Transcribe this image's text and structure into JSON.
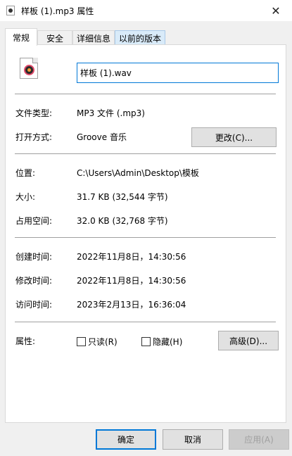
{
  "window": {
    "title": "样板 (1).mp3 属性"
  },
  "tabs": [
    {
      "label": "常规",
      "active": true
    },
    {
      "label": "安全",
      "active": false
    },
    {
      "label": "详细信息",
      "active": false
    },
    {
      "label": "以前的版本",
      "active": false
    }
  ],
  "file": {
    "name_value": "样板 (1).wav"
  },
  "general": {
    "type_label": "文件类型:",
    "type_value": "MP3 文件 (.mp3)",
    "opens_label": "打开方式:",
    "opens_value": "Groove 音乐",
    "change_button": "更改(C)...",
    "location_label": "位置:",
    "location_value": "C:\\Users\\Admin\\Desktop\\模板",
    "size_label": "大小:",
    "size_value": "31.7 KB (32,544 字节)",
    "disk_label": "占用空间:",
    "disk_value": "32.0 KB (32,768 字节)",
    "created_label": "创建时间:",
    "created_value": "2022年11月8日，14:30:56",
    "modified_label": "修改时间:",
    "modified_value": "2022年11月8日，14:30:56",
    "accessed_label": "访问时间:",
    "accessed_value": "2023年2月13日，16:36:04",
    "attrs_label": "属性:",
    "readonly_label": "只读(R)",
    "hidden_label": "隐藏(H)",
    "advanced_button": "高级(D)..."
  },
  "footer": {
    "ok": "确定",
    "cancel": "取消",
    "apply": "应用(A)"
  },
  "icons": {
    "title": "mp3-file-icon",
    "file": "music-file-icon",
    "close": "close-icon"
  },
  "colors": {
    "accent": "#0078d7",
    "tab_hover": "#d9ebf9"
  }
}
